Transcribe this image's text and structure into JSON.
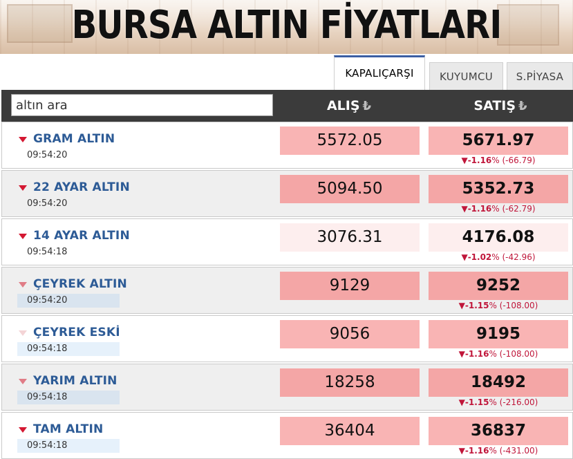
{
  "banner": {
    "title": "BURSA ALTIN FİYATLARI"
  },
  "tabs": [
    {
      "label": "KAPALIÇARŞI",
      "active": true
    },
    {
      "label": "KUYUMCU",
      "active": false
    },
    {
      "label": "S.PİYASA",
      "active": false
    }
  ],
  "header": {
    "search_value": "altın ara",
    "alis_label": "ALIŞ",
    "satis_label": "SATIŞ",
    "currency_symbol": "₺"
  },
  "colors": {
    "accent": "#3b5ea3",
    "header_bg": "#3b3b3b",
    "name_blue": "#2d5b96",
    "down_red": "#c0163a"
  },
  "rows": [
    {
      "name": "GRAM ALTIN",
      "time": "09:54:20",
      "alis": "5572.05",
      "satis": "5671.97",
      "pct": "-1.16",
      "diff": "(-66.79)",
      "alis_bg": "#f9b4b4",
      "satis_bg": "#f9b4b4",
      "time_bg": "transparent",
      "arrow_color": "#d41832",
      "alt": false
    },
    {
      "name": "22 AYAR ALTIN",
      "time": "09:54:20",
      "alis": "5094.50",
      "satis": "5352.73",
      "pct": "-1.16",
      "diff": "(-62.79)",
      "alis_bg": "#f4a6a6",
      "satis_bg": "#f4a6a6",
      "time_bg": "transparent",
      "arrow_color": "#d41832",
      "alt": true
    },
    {
      "name": "14 AYAR ALTIN",
      "time": "09:54:18",
      "alis": "3076.31",
      "satis": "4176.08",
      "pct": "-1.02",
      "diff": "(-42.96)",
      "alis_bg": "#fdeeee",
      "satis_bg": "#fdeeee",
      "time_bg": "transparent",
      "arrow_color": "#d41832",
      "alt": false
    },
    {
      "name": "ÇEYREK ALTIN",
      "time": "09:54:20",
      "alis": "9129",
      "satis": "9252",
      "pct": "-1.15",
      "diff": "(-108.00)",
      "alis_bg": "#f4a6a6",
      "satis_bg": "#f4a6a6",
      "time_bg": "#d9e4ef",
      "arrow_color": "#e07c86",
      "alt": true
    },
    {
      "name": "ÇEYREK ESKİ",
      "time": "09:54:18",
      "alis": "9056",
      "satis": "9195",
      "pct": "-1.16",
      "diff": "(-108.00)",
      "alis_bg": "#f9b4b4",
      "satis_bg": "#f9b4b4",
      "time_bg": "#e6f1fb",
      "arrow_color": "#f4d4d6",
      "alt": false
    },
    {
      "name": "YARIM ALTIN",
      "time": "09:54:18",
      "alis": "18258",
      "satis": "18492",
      "pct": "-1.15",
      "diff": "(-216.00)",
      "alis_bg": "#f4a6a6",
      "satis_bg": "#f4a6a6",
      "time_bg": "#d9e4ef",
      "arrow_color": "#e07c86",
      "alt": true
    },
    {
      "name": "TAM ALTIN",
      "time": "09:54:18",
      "alis": "36404",
      "satis": "36837",
      "pct": "-1.16",
      "diff": "(-431.00)",
      "alis_bg": "#f9b4b4",
      "satis_bg": "#f9b4b4",
      "time_bg": "#e6f1fb",
      "arrow_color": "#d41832",
      "alt": false
    }
  ]
}
